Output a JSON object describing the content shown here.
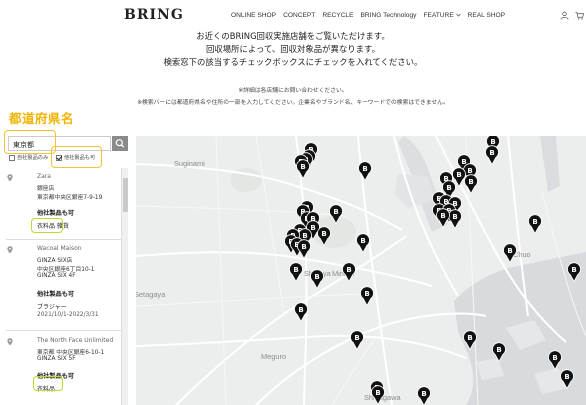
{
  "header": {
    "logo": "BRING",
    "nav": [
      "ONLINE SHOP",
      "CONCEPT",
      "RECYCLE",
      "BRING Technology",
      "FEATURE",
      "REAL SHOP"
    ],
    "dropdown_icon": "chevron-down-icon",
    "account_icon": "user-icon",
    "cart_icon": "cart-icon"
  },
  "intro": {
    "lines": [
      "お近くのBRING回収実施店舗をご覧いただけます。",
      "回収場所によって、回収対象品が異なります。",
      "検索窓下の該当するチェックボックスにチェックを入れてください。"
    ],
    "note1": "※詳細は各店舗にお問い合わせください。",
    "note2": "※検索バーには都道府県名や住所の一部を入力してください。企業名やブランド名、キーワードでの検索はできません。"
  },
  "filter": {
    "pref_label": "都道府県名",
    "search_value": "東京都",
    "search_icon": "search-icon",
    "checkboxes": [
      {
        "label": "自社製品のみ",
        "checked": false
      },
      {
        "label": "他社製品も可",
        "checked": true
      }
    ]
  },
  "stores": [
    {
      "name": "Zara",
      "lines": [
        "銀座店",
        "東京都中央区銀座7-9-19"
      ],
      "tag_heading": "他社製品も可",
      "tag": "衣料品 雑貨"
    },
    {
      "name": "Wacoal Maison",
      "lines": [
        "GINZA SIX店",
        "中央区銀座6丁目10-1",
        "GINZA SIX 4F"
      ],
      "tag_heading": "他社製品も可",
      "tag": "ブラジャー",
      "period": "2021/10/1-2022/3/31"
    },
    {
      "name": "The North Face Unlimited",
      "lines": [
        "東京都 中央区銀座6-10-1",
        "GINZA SIX 5F"
      ],
      "tag_heading": "他社製品も可",
      "tag": "衣料品"
    }
  ],
  "map": {
    "labels": [
      "Suginami",
      "Shibuya",
      "Minato",
      "Setagaya",
      "Meguro",
      "Shinagawa",
      "Chuo"
    ],
    "marker_letter": "B"
  },
  "colors": {
    "accent_yellow": "#f0b400",
    "highlight_green": "#b8dd2b",
    "marker": "#111111"
  }
}
